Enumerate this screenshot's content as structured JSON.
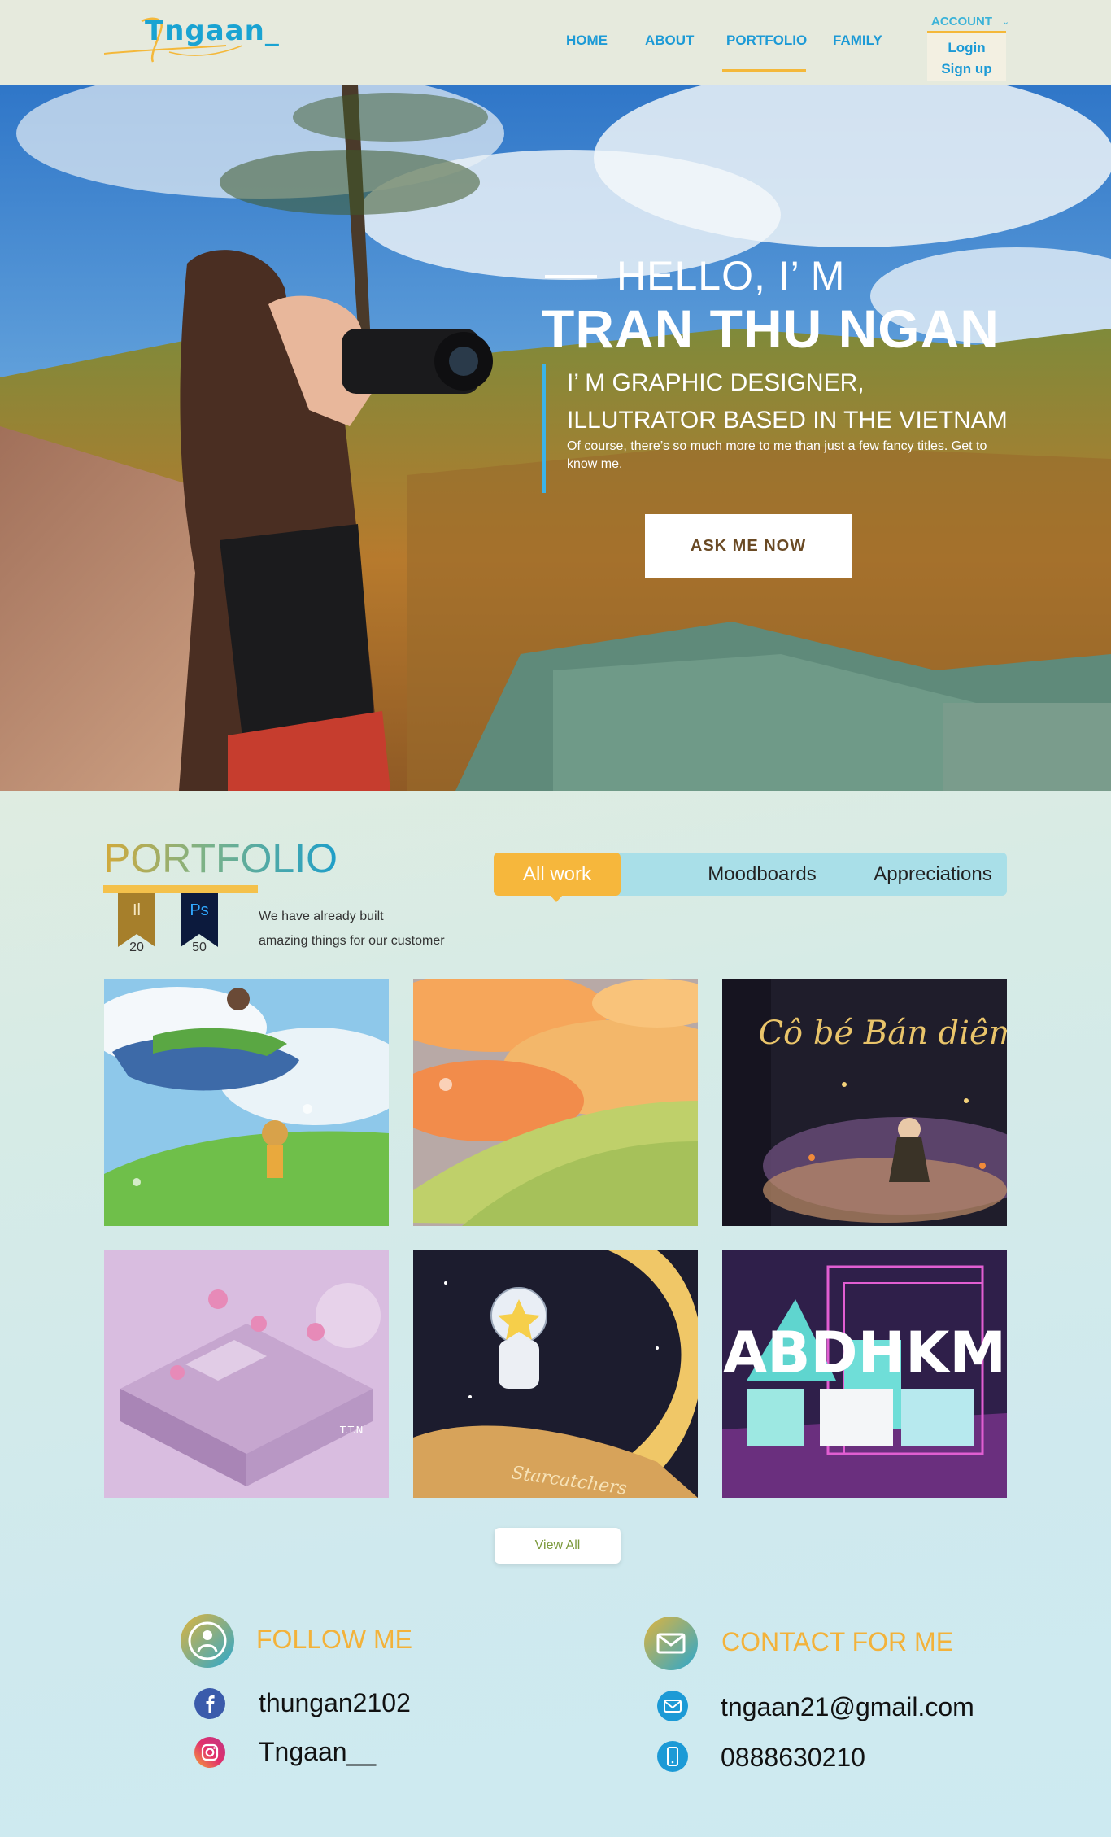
{
  "header": {
    "logo_text": "Tngaan_",
    "nav": [
      {
        "label": "HOME"
      },
      {
        "label": "ABOUT"
      },
      {
        "label": "PORTFOLIO"
      },
      {
        "label": "FAMILY"
      }
    ],
    "active_nav": "PORTFOLIO",
    "account": {
      "label": "ACCOUNT",
      "menu": [
        "Login",
        "Sign up"
      ]
    }
  },
  "hero": {
    "greeting": "HELLO, I’ M",
    "name": "TRAN THU NGAN",
    "role_line1": "I’ M GRAPHIC DESIGNER,",
    "role_line2": "ILLUTRATOR BASED IN THE VIETNAM",
    "description": "Of course, there’s so much more to me than just a few fancy titles. Get to know me.",
    "cta_label": "ASK ME NOW"
  },
  "portfolio": {
    "title": "PORTFOLIO",
    "tabs": [
      "All work",
      "Moodboards",
      "Appreciations"
    ],
    "active_tab": "All work",
    "badges": [
      {
        "label": "Il",
        "count": "20",
        "color": "#a67f2b",
        "text_color": "#f6e7c0"
      },
      {
        "label": "Ps",
        "count": "50",
        "color": "#0c1a3d",
        "text_color": "#31a8ff"
      }
    ],
    "description_line1": "We have already built",
    "description_line2": "amazing things for our customer",
    "works": [
      {
        "name": "whale-sky-illustration",
        "caption": ""
      },
      {
        "name": "sunset-clouds-illustration",
        "caption": ""
      },
      {
        "name": "book-cover-illustration",
        "caption": "Cô bé Bán diêm"
      },
      {
        "name": "isometric-21-illustration",
        "caption": "T.T.N"
      },
      {
        "name": "starcatchers-illustration",
        "caption": "Starcatchers"
      },
      {
        "name": "typography-3d-illustration",
        "caption": "ABDHKM"
      }
    ],
    "view_all_label": "View All"
  },
  "follow": {
    "title": "FOLLOW ME",
    "facebook": "thungan2102",
    "instagram": "Tngaan__"
  },
  "contact": {
    "title": "CONTACT FOR ME",
    "email": "tngaan21@gmail.com",
    "phone": "0888630210"
  },
  "colors": {
    "accent_blue": "#1c9ad6",
    "accent_gold": "#f4b83a",
    "tab_bg": "#a9dfe8"
  }
}
